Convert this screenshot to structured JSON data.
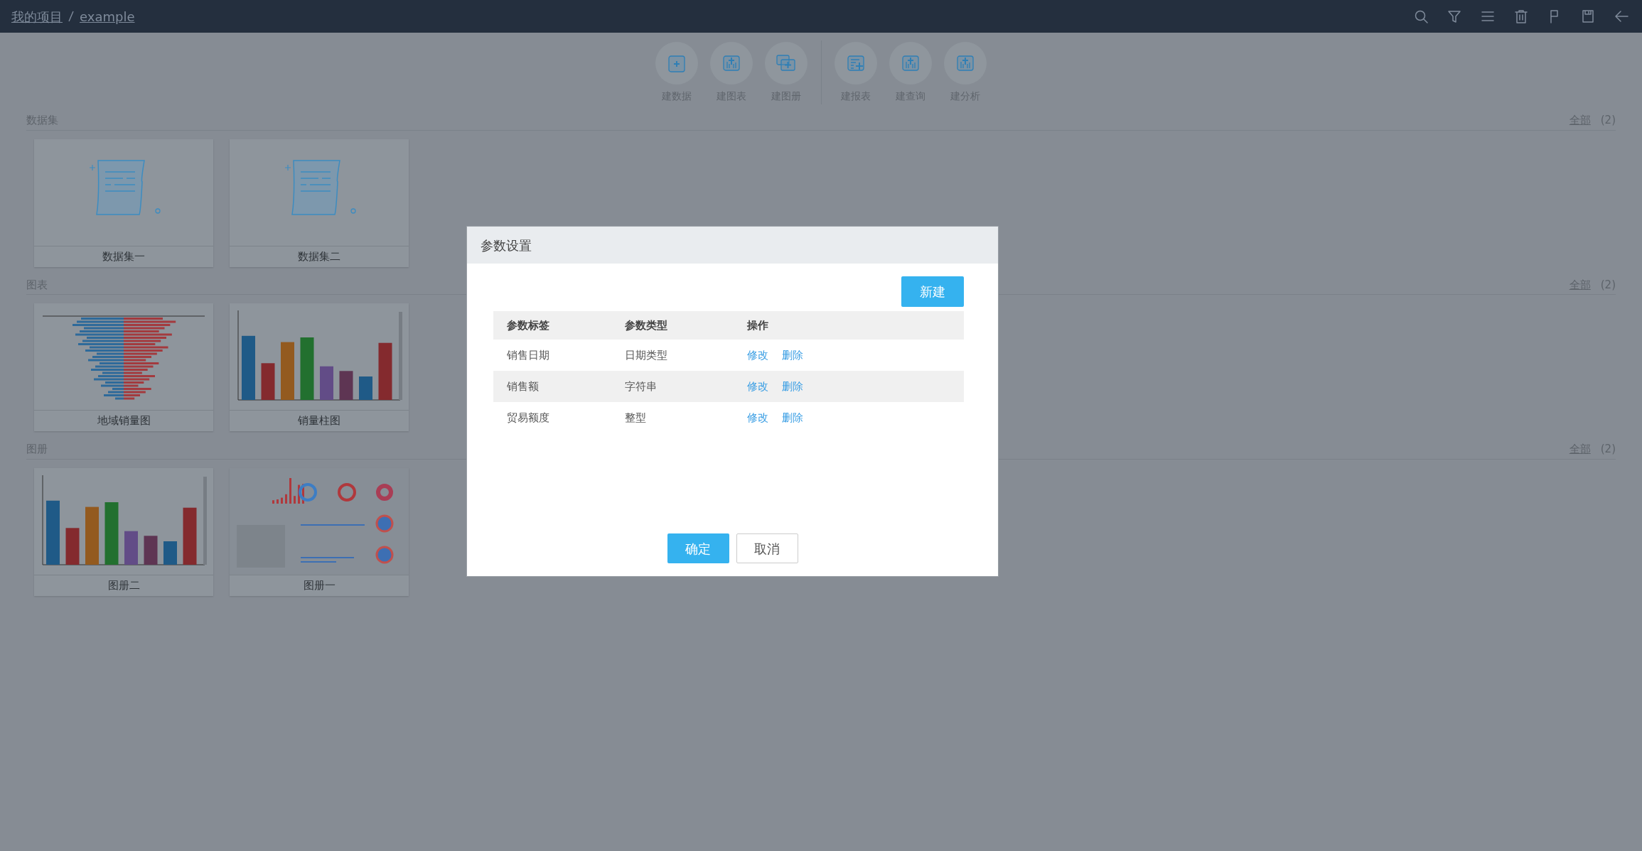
{
  "breadcrumb": [
    "我的项目",
    "example"
  ],
  "toolbar": [
    [
      {
        "label": "建数据",
        "kind": "data"
      },
      {
        "label": "建图表",
        "kind": "chart"
      },
      {
        "label": "建图册",
        "kind": "album"
      }
    ],
    [
      {
        "label": "建报表",
        "kind": "report"
      },
      {
        "label": "建查询",
        "kind": "chart"
      },
      {
        "label": "建分析",
        "kind": "chart"
      }
    ]
  ],
  "sections": [
    {
      "title": "数据集",
      "all_label": "全部",
      "count": "(2)",
      "items": [
        {
          "name": "数据集一",
          "kind": "dataset"
        },
        {
          "name": "数据集二",
          "kind": "dataset"
        }
      ]
    },
    {
      "title": "图表",
      "all_label": "全部",
      "count": "(2)",
      "items": [
        {
          "name": "地域销量图",
          "kind": "butterfly"
        },
        {
          "name": "销量柱图",
          "kind": "bar"
        }
      ]
    },
    {
      "title": "图册",
      "all_label": "全部",
      "count": "(2)",
      "items": [
        {
          "name": "图册二",
          "kind": "bar"
        },
        {
          "name": "图册一",
          "kind": "dashboard"
        }
      ]
    }
  ],
  "dialog": {
    "title": "参数设置",
    "new_button": "新建",
    "columns": [
      "参数标签",
      "参数类型",
      "操作"
    ],
    "rows": [
      {
        "label": "销售日期",
        "type": "日期类型",
        "actions": [
          "修改",
          "删除"
        ]
      },
      {
        "label": "销售额",
        "type": "字符串",
        "actions": [
          "修改",
          "删除"
        ]
      },
      {
        "label": "贸易额度",
        "type": "整型",
        "actions": [
          "修改",
          "删除"
        ]
      }
    ],
    "confirm": "确定",
    "cancel": "取消"
  }
}
